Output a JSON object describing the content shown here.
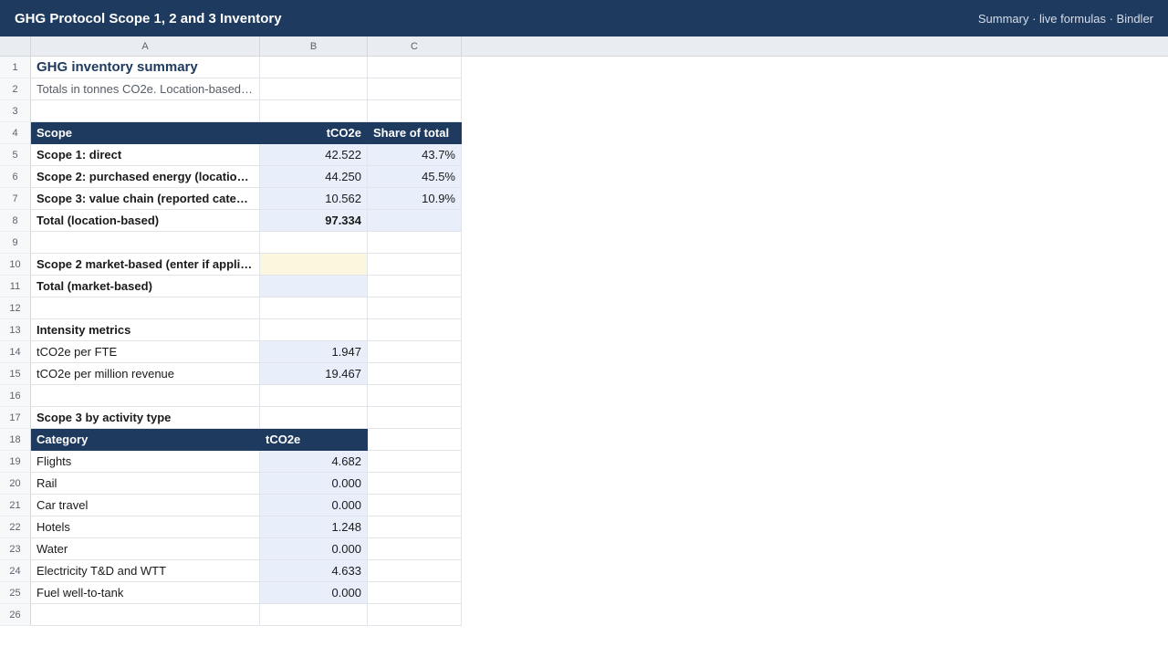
{
  "app": {
    "title": "GHG Protocol Scope 1, 2 and 3 Inventory",
    "meta": "Summary · live formulas · Bindler"
  },
  "columns": [
    "A",
    "B",
    "C"
  ],
  "rows": [
    {
      "n": "1",
      "a": "GHG inventory summary",
      "b": "",
      "c": ""
    },
    {
      "n": "2",
      "a": "Totals in tonnes CO2e. Location-based …",
      "b": "",
      "c": ""
    },
    {
      "n": "3",
      "a": "",
      "b": "",
      "c": ""
    },
    {
      "n": "4",
      "a": "Scope",
      "b": "tCO2e",
      "c": "Share of total"
    },
    {
      "n": "5",
      "a": "Scope 1: direct",
      "b": "42.522",
      "c": "43.7%"
    },
    {
      "n": "6",
      "a": "Scope 2: purchased energy (location-…",
      "b": "44.250",
      "c": "45.5%"
    },
    {
      "n": "7",
      "a": "Scope 3: value chain (reported catego…",
      "b": "10.562",
      "c": "10.9%"
    },
    {
      "n": "8",
      "a": "Total (location-based)",
      "b": "97.334",
      "c": ""
    },
    {
      "n": "9",
      "a": "",
      "b": "",
      "c": ""
    },
    {
      "n": "10",
      "a": "Scope 2 market-based (enter if applic…",
      "b": "",
      "c": ""
    },
    {
      "n": "11",
      "a": "Total (market-based)",
      "b": "",
      "c": ""
    },
    {
      "n": "12",
      "a": "",
      "b": "",
      "c": ""
    },
    {
      "n": "13",
      "a": "Intensity metrics",
      "b": "",
      "c": ""
    },
    {
      "n": "14",
      "a": "tCO2e per FTE",
      "b": "1.947",
      "c": ""
    },
    {
      "n": "15",
      "a": "tCO2e per million revenue",
      "b": "19.467",
      "c": ""
    },
    {
      "n": "16",
      "a": "",
      "b": "",
      "c": ""
    },
    {
      "n": "17",
      "a": "Scope 3 by activity type",
      "b": "",
      "c": ""
    },
    {
      "n": "18",
      "a": "Category",
      "b": "tCO2e",
      "c": ""
    },
    {
      "n": "19",
      "a": "Flights",
      "b": "4.682",
      "c": ""
    },
    {
      "n": "20",
      "a": "Rail",
      "b": "0.000",
      "c": ""
    },
    {
      "n": "21",
      "a": "Car travel",
      "b": "0.000",
      "c": ""
    },
    {
      "n": "22",
      "a": "Hotels",
      "b": "1.248",
      "c": ""
    },
    {
      "n": "23",
      "a": "Water",
      "b": "0.000",
      "c": ""
    },
    {
      "n": "24",
      "a": "Electricity T&D and WTT",
      "b": "4.633",
      "c": ""
    },
    {
      "n": "25",
      "a": "Fuel well-to-tank",
      "b": "0.000",
      "c": ""
    },
    {
      "n": "26",
      "a": "",
      "b": "",
      "c": ""
    }
  ],
  "colors": {
    "header_navy": "#1e3a5f",
    "calc_fill": "#e8effb",
    "input_fill": "#fdf6df"
  }
}
